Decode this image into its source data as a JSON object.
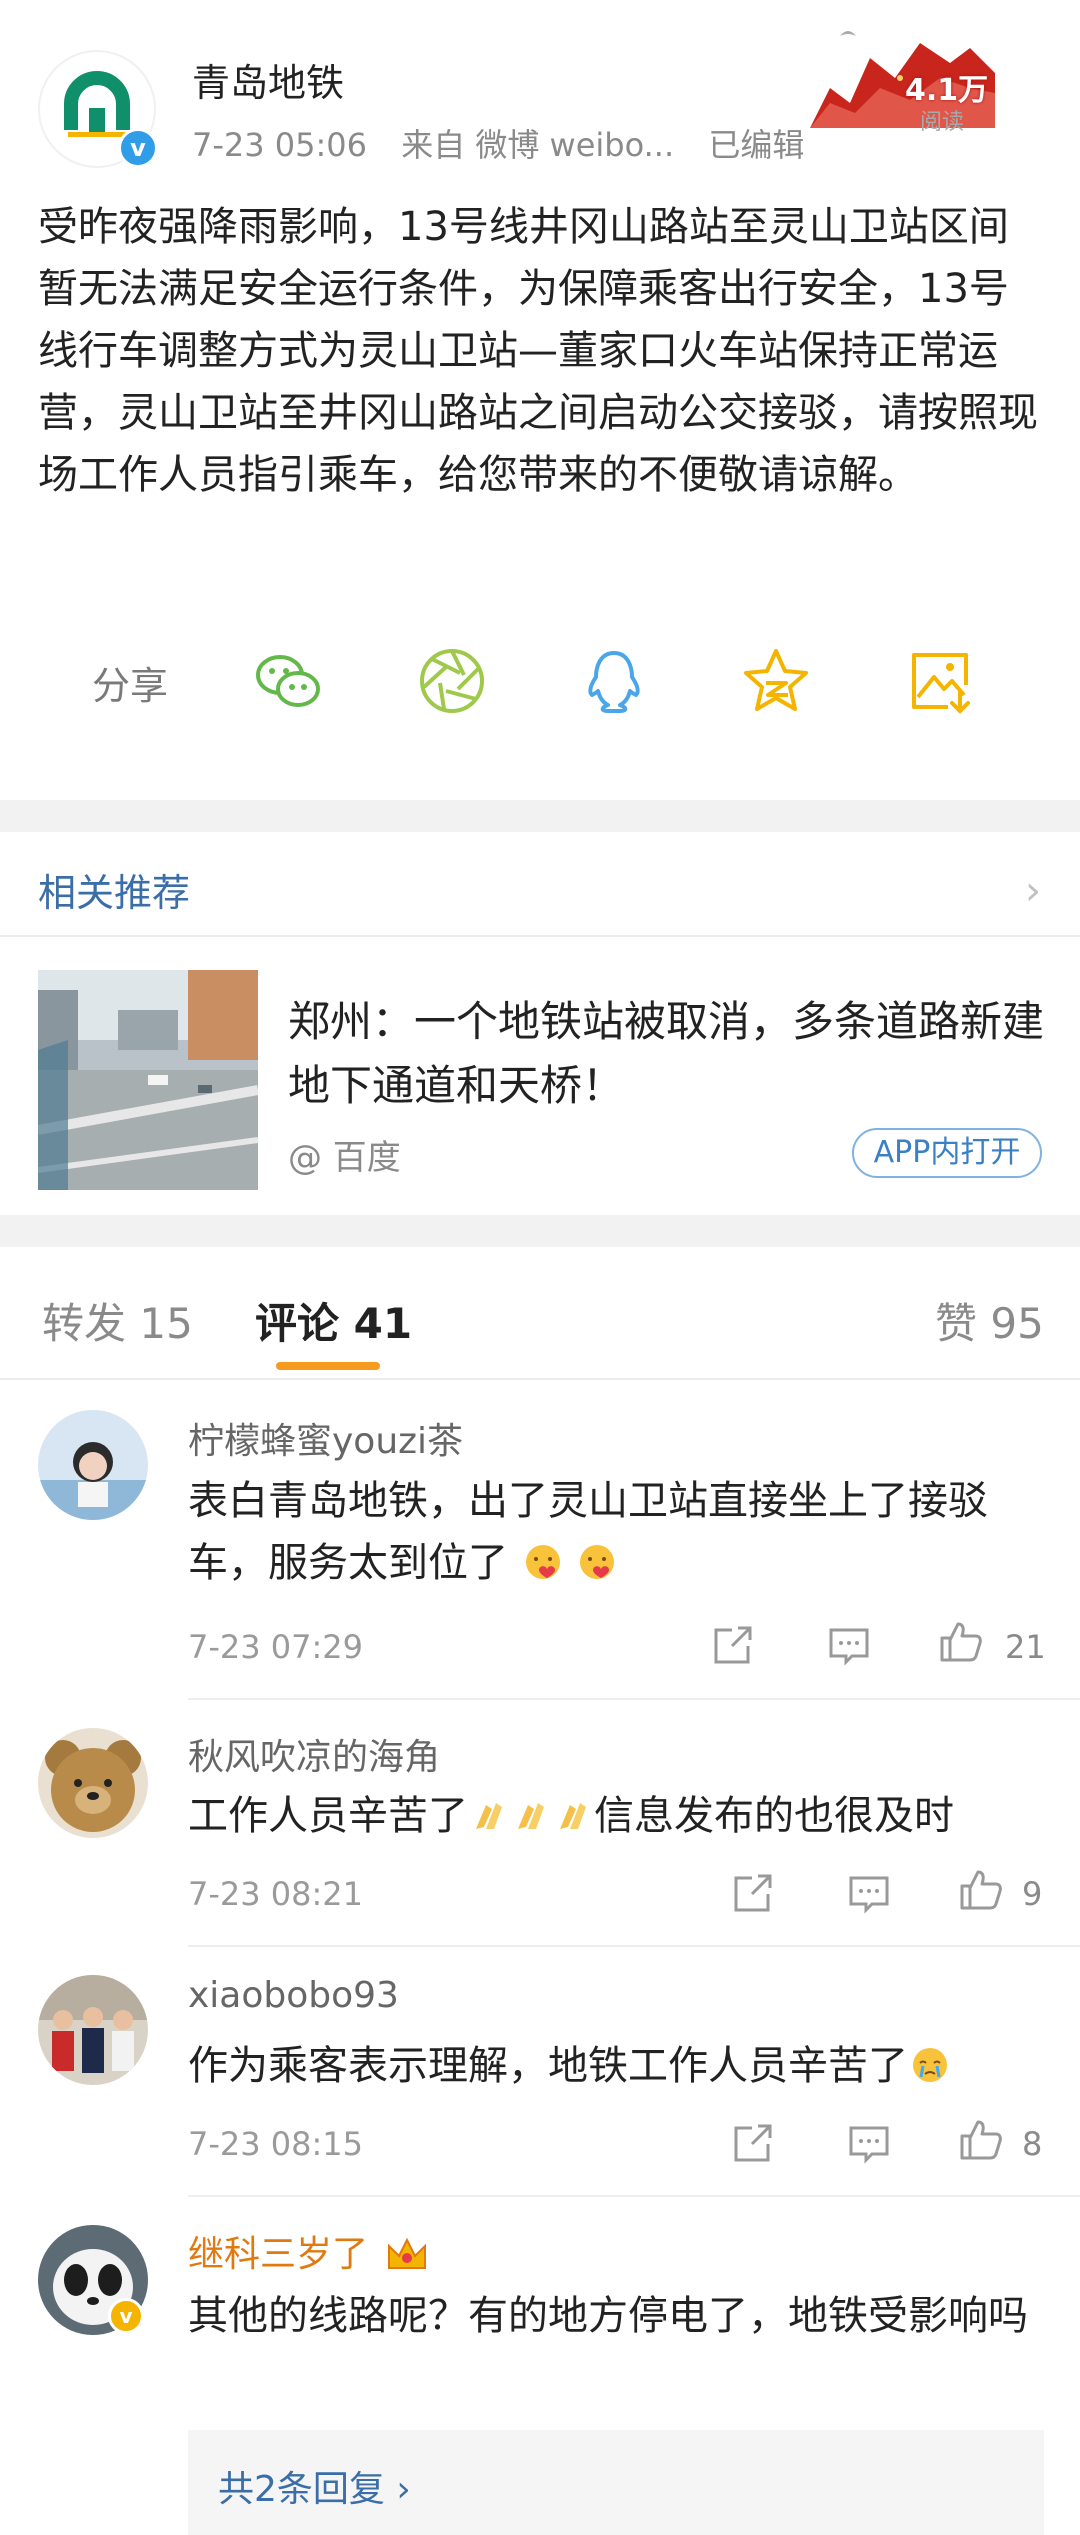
{
  "post": {
    "author": "青岛地铁",
    "verified_mark": "v",
    "time": "7-23 05:06",
    "source": "来自 微博 weibo...",
    "edited": "已编辑",
    "read_count": "4.1万",
    "read_label": "阅读",
    "body": "受昨夜强降雨影响，13号线井冈山路站至灵山卫站区间暂无法满足安全运行条件，为保障乘客出行安全，13号线行车调整方式为灵山卫站—董家口火车站保持正常运营，灵山卫站至井冈山路站之间启动公交接驳，请按照现场工作人员指引乘车，给您带来的不便敬请谅解。"
  },
  "share": {
    "label": "分享",
    "icons": [
      "wechat-icon",
      "moments-icon",
      "qq-icon",
      "qzone-star-icon",
      "save-image-icon"
    ],
    "colors": {
      "green": "#62b94a",
      "qq": "#4aa6e8",
      "star": "#f4b400",
      "image": "#f4b400"
    }
  },
  "related": {
    "header": "相关推荐",
    "title": "郑州：一个地铁站被取消，多条道路新建地下通道和天桥！",
    "source": "@ 百度",
    "app_button": "APP内打开"
  },
  "tabs": {
    "forward": "转发 15",
    "comments": "评论 41",
    "likes": "赞 95",
    "active_color": "#f79b1e"
  },
  "comments": [
    {
      "name": "柠檬蜂蜜youzi茶",
      "text": "表白青岛地铁，出了灵山卫站直接坐上了接驳车，服务太到位了",
      "time": "7-23 07:29",
      "likes": "21",
      "emojis": [
        "heart-face-emoji",
        "heart-face-emoji"
      ]
    },
    {
      "name": "秋风吹凉的海角",
      "text_before": "工作人员辛苦了",
      "text_after": "信息发布的也很及时",
      "time": "7-23 08:21",
      "likes": "9",
      "emojis": [
        "clap-emoji",
        "clap-emoji",
        "clap-emoji"
      ]
    },
    {
      "name": "xiaobobo93",
      "text": "作为乘客表示理解，地铁工作人员辛苦了",
      "time": "7-23 08:15",
      "likes": "8",
      "emojis": [
        "cry-face-emoji"
      ]
    },
    {
      "name": "继科三岁了",
      "text": "其他的线路呢？有的地方停电了，地铁受影响吗",
      "replies": "共2条回复 ›",
      "badge": "crown-badge-icon"
    }
  ]
}
